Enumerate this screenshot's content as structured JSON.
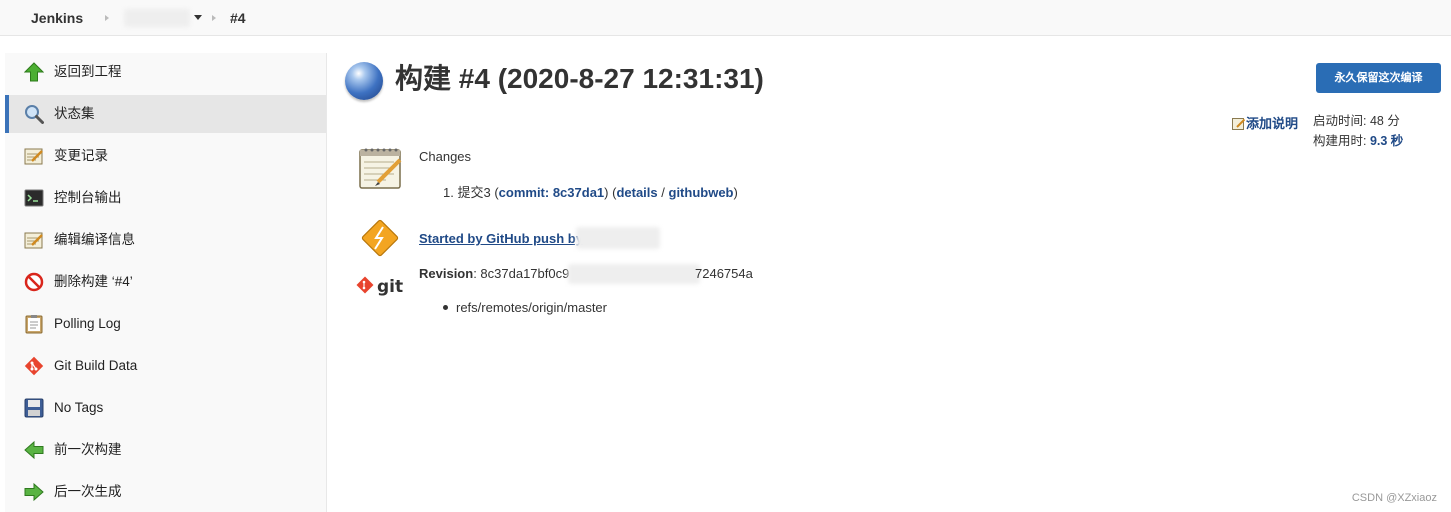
{
  "breadcrumb": {
    "root": "Jenkins",
    "build": "#4"
  },
  "sidebar": {
    "items": [
      {
        "label": "返回到工程",
        "icon": "up-arrow-icon"
      },
      {
        "label": "状态集",
        "icon": "search-icon",
        "active": true
      },
      {
        "label": "变更记录",
        "icon": "notepad-icon"
      },
      {
        "label": "控制台输出",
        "icon": "terminal-icon"
      },
      {
        "label": "编辑编译信息",
        "icon": "notepad-icon"
      },
      {
        "label": "删除构建 ‘#4’",
        "icon": "no-entry-icon"
      },
      {
        "label": "Polling Log",
        "icon": "clipboard-icon"
      },
      {
        "label": "Git Build Data",
        "icon": "git-icon"
      },
      {
        "label": "No Tags",
        "icon": "floppy-icon"
      },
      {
        "label": "前一次构建",
        "icon": "left-arrow-icon"
      },
      {
        "label": "后一次生成",
        "icon": "right-arrow-icon"
      }
    ]
  },
  "main": {
    "title": "构建 #4 (2020-8-27 12:31:31)",
    "keep_button": "永久保留这次编译",
    "add_description": "添加说明",
    "started_label": "启动时间: 48 分",
    "duration_label": "构建用时: ",
    "duration_value": "9.3 秒",
    "changes": {
      "heading": "Changes",
      "item_number": "1.",
      "item_text": "提交3",
      "commit_link": "commit: 8c37da1",
      "details_link": "details",
      "separator": "/",
      "githubweb_link": "githubweb"
    },
    "trigger": "Started by GitHub push by",
    "revision": {
      "label": "Revision",
      "prefix": "8c37da17bf0c9",
      "suffix": "7246754a"
    },
    "branch": "refs/remotes/origin/master"
  },
  "colors": {
    "accent": "#2a6db5",
    "link": "#204a87",
    "sidebar_active_border": "#3b73b9"
  },
  "watermark": "CSDN @XZxiaoz"
}
